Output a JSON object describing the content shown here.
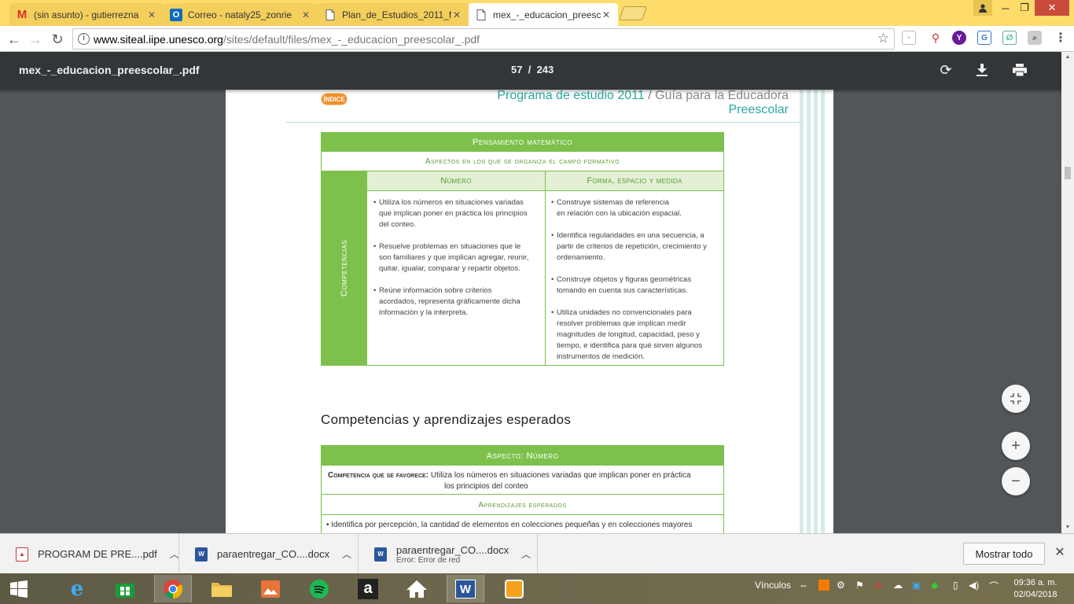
{
  "browser": {
    "tabs": [
      {
        "label": "(sin asunto) - gutierrezna",
        "icon": "gmail-icon"
      },
      {
        "label": "Correo - nataly25_zonrie",
        "icon": "outlook-icon"
      },
      {
        "label": "Plan_de_Estudios_2011_f",
        "icon": "document-icon"
      },
      {
        "label": "mex_-_educacion_preesc",
        "icon": "document-icon",
        "active": true
      }
    ],
    "url_host": "www.siteal.iipe.unesco.org",
    "url_path": "/sites/default/files/mex_-_educacion_preescolar_.pdf"
  },
  "pdf_toolbar": {
    "filename": "mex_-_educacion_preescolar_.pdf",
    "current_page": "57",
    "separator": "/",
    "total_pages": "243"
  },
  "page": {
    "indice_label": "ÍNDICE",
    "header_program": "Programa de estudio 2011",
    "header_slash": "/",
    "header_guide": "Guía para la Educadora",
    "header_level": "Preescolar",
    "table1": {
      "title": "Pensamiento matemático",
      "subtitle": "Aspectos en los que se organiza el campo formativo",
      "side_label": "Competencias",
      "col1_header": "Número",
      "col2_header": "Forma, espacio y medida",
      "col1_items": [
        {
          "l1": "Utiliza los números en situaciones variadas",
          "l2": "que implican poner en práctica los principios",
          "l3": "del conteo."
        },
        {
          "l1": "Resuelve problemas en situaciones que le",
          "l2": "son familiares y que implican agregar, reunir,",
          "l3": "quitar, igualar, comparar y repartir objetos."
        },
        {
          "l1": "Reúne información sobre criterios",
          "l2": "acordados, representa gráficamente dicha",
          "l3": "información y la interpreta."
        }
      ],
      "col2_items": [
        {
          "l1": "Construye sistemas de referencia",
          "l2": "en relación con la ubicación espacial."
        },
        {
          "l1": "Identifica regularidades en una secuencia, a",
          "l2": "partir de criterios de repetición, crecimiento y",
          "l3": "ordenamiento."
        },
        {
          "l1": "Construye objetos y figuras geométricas",
          "l2": "tomando en cuenta sus características."
        },
        {
          "l1": "Utiliza unidades no convencionales para",
          "l2": "resolver problemas que implican medir",
          "l3": "magnitudes de longitud, capacidad, peso y",
          "l4": "tiempo, e identifica para qué sirven algunos",
          "l5": "instrumentos de medición."
        }
      ]
    },
    "section_heading": "Competencias y aprendizajes esperados",
    "table2": {
      "aspect": "Aspecto: Número",
      "competencia_key": "Competencia que se favorece:",
      "competencia_line1": "Utiliza los números en situaciones variadas que implican poner en práctica",
      "competencia_line2": "los principios del conteo",
      "aprendizajes": "Aprendizajes esperados",
      "first_item": "Identifica por percepción, la cantidad de elementos en colecciones pequeñas y en colecciones mayores"
    }
  },
  "downloads": {
    "items": [
      {
        "name": "PROGRAM DE PRE....pdf",
        "sub": ""
      },
      {
        "name": "paraentregar_CO....docx",
        "sub": ""
      },
      {
        "name": "paraentregar_CO....docx",
        "sub": "Error: Error de red"
      }
    ],
    "show_all": "Mostrar todo"
  },
  "taskbar": {
    "links_label": "Vínculos",
    "time": "09:36 a. m.",
    "date": "02/04/2018"
  },
  "colors": {
    "tab_strip": "#fddc6c",
    "pdf_toolbar": "#323639",
    "green_accent": "#7dc14c",
    "teal_header": "#2aa8a0"
  }
}
